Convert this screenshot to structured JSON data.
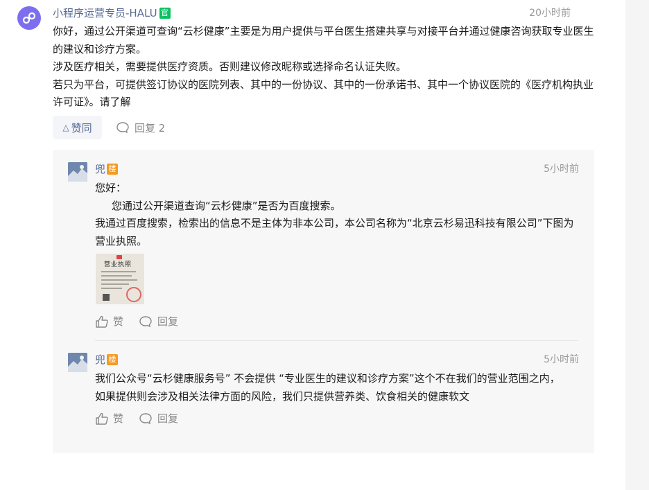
{
  "main_comment": {
    "author": "小程序运营专员-HALU",
    "official_badge": "官",
    "time": "20小时前",
    "paragraphs": [
      "你好，通过公开渠道可查询“云杉健康”主要是为用户提供与平台医生搭建共享与对接平台并通过健康咨询获取专业医生的建议和诊疗方案。",
      "涉及医疗相关，需要提供医疗资质。否则建议修改昵称或选择命名认证失败。",
      "若只为平台，可提供签订协议的医院列表、其中的一份协议、其中的一份承诺书、其中一个协议医院的《医疗机构执业许可证》。请了解"
    ],
    "agree_label": "赞同",
    "reply_label": "回复 2"
  },
  "replies": [
    {
      "author": "兜",
      "floor_badge": "楼",
      "time": "5小时前",
      "lines": [
        "您好：",
        "您通过公开渠道查询“云杉健康”是否为百度搜索。",
        "我通过百度搜索，检索出的信息不是主体为非本公司，本公司名称为“北京云杉易迅科技有限公司”下图为营业执照。"
      ],
      "image_caption": "营业执照",
      "like_label": "赞",
      "reply_label": "回复"
    },
    {
      "author": "兜",
      "floor_badge": "楼",
      "time": "5小时前",
      "lines": [
        "我们公众号“云杉健康服务号” 不会提供 “专业医生的建议和诊疗方案”这个不在我们的营业范围之内，如果提供则会涉及相关法律方面的风险，我们只提供营养类、饮食相关的健康软文"
      ],
      "like_label": "赞",
      "reply_label": "回复"
    }
  ],
  "colors": {
    "link": "#576b95",
    "muted": "#999999",
    "official": "#07c160",
    "floor": "#f59a23",
    "avatar": "#7d6ef0"
  }
}
